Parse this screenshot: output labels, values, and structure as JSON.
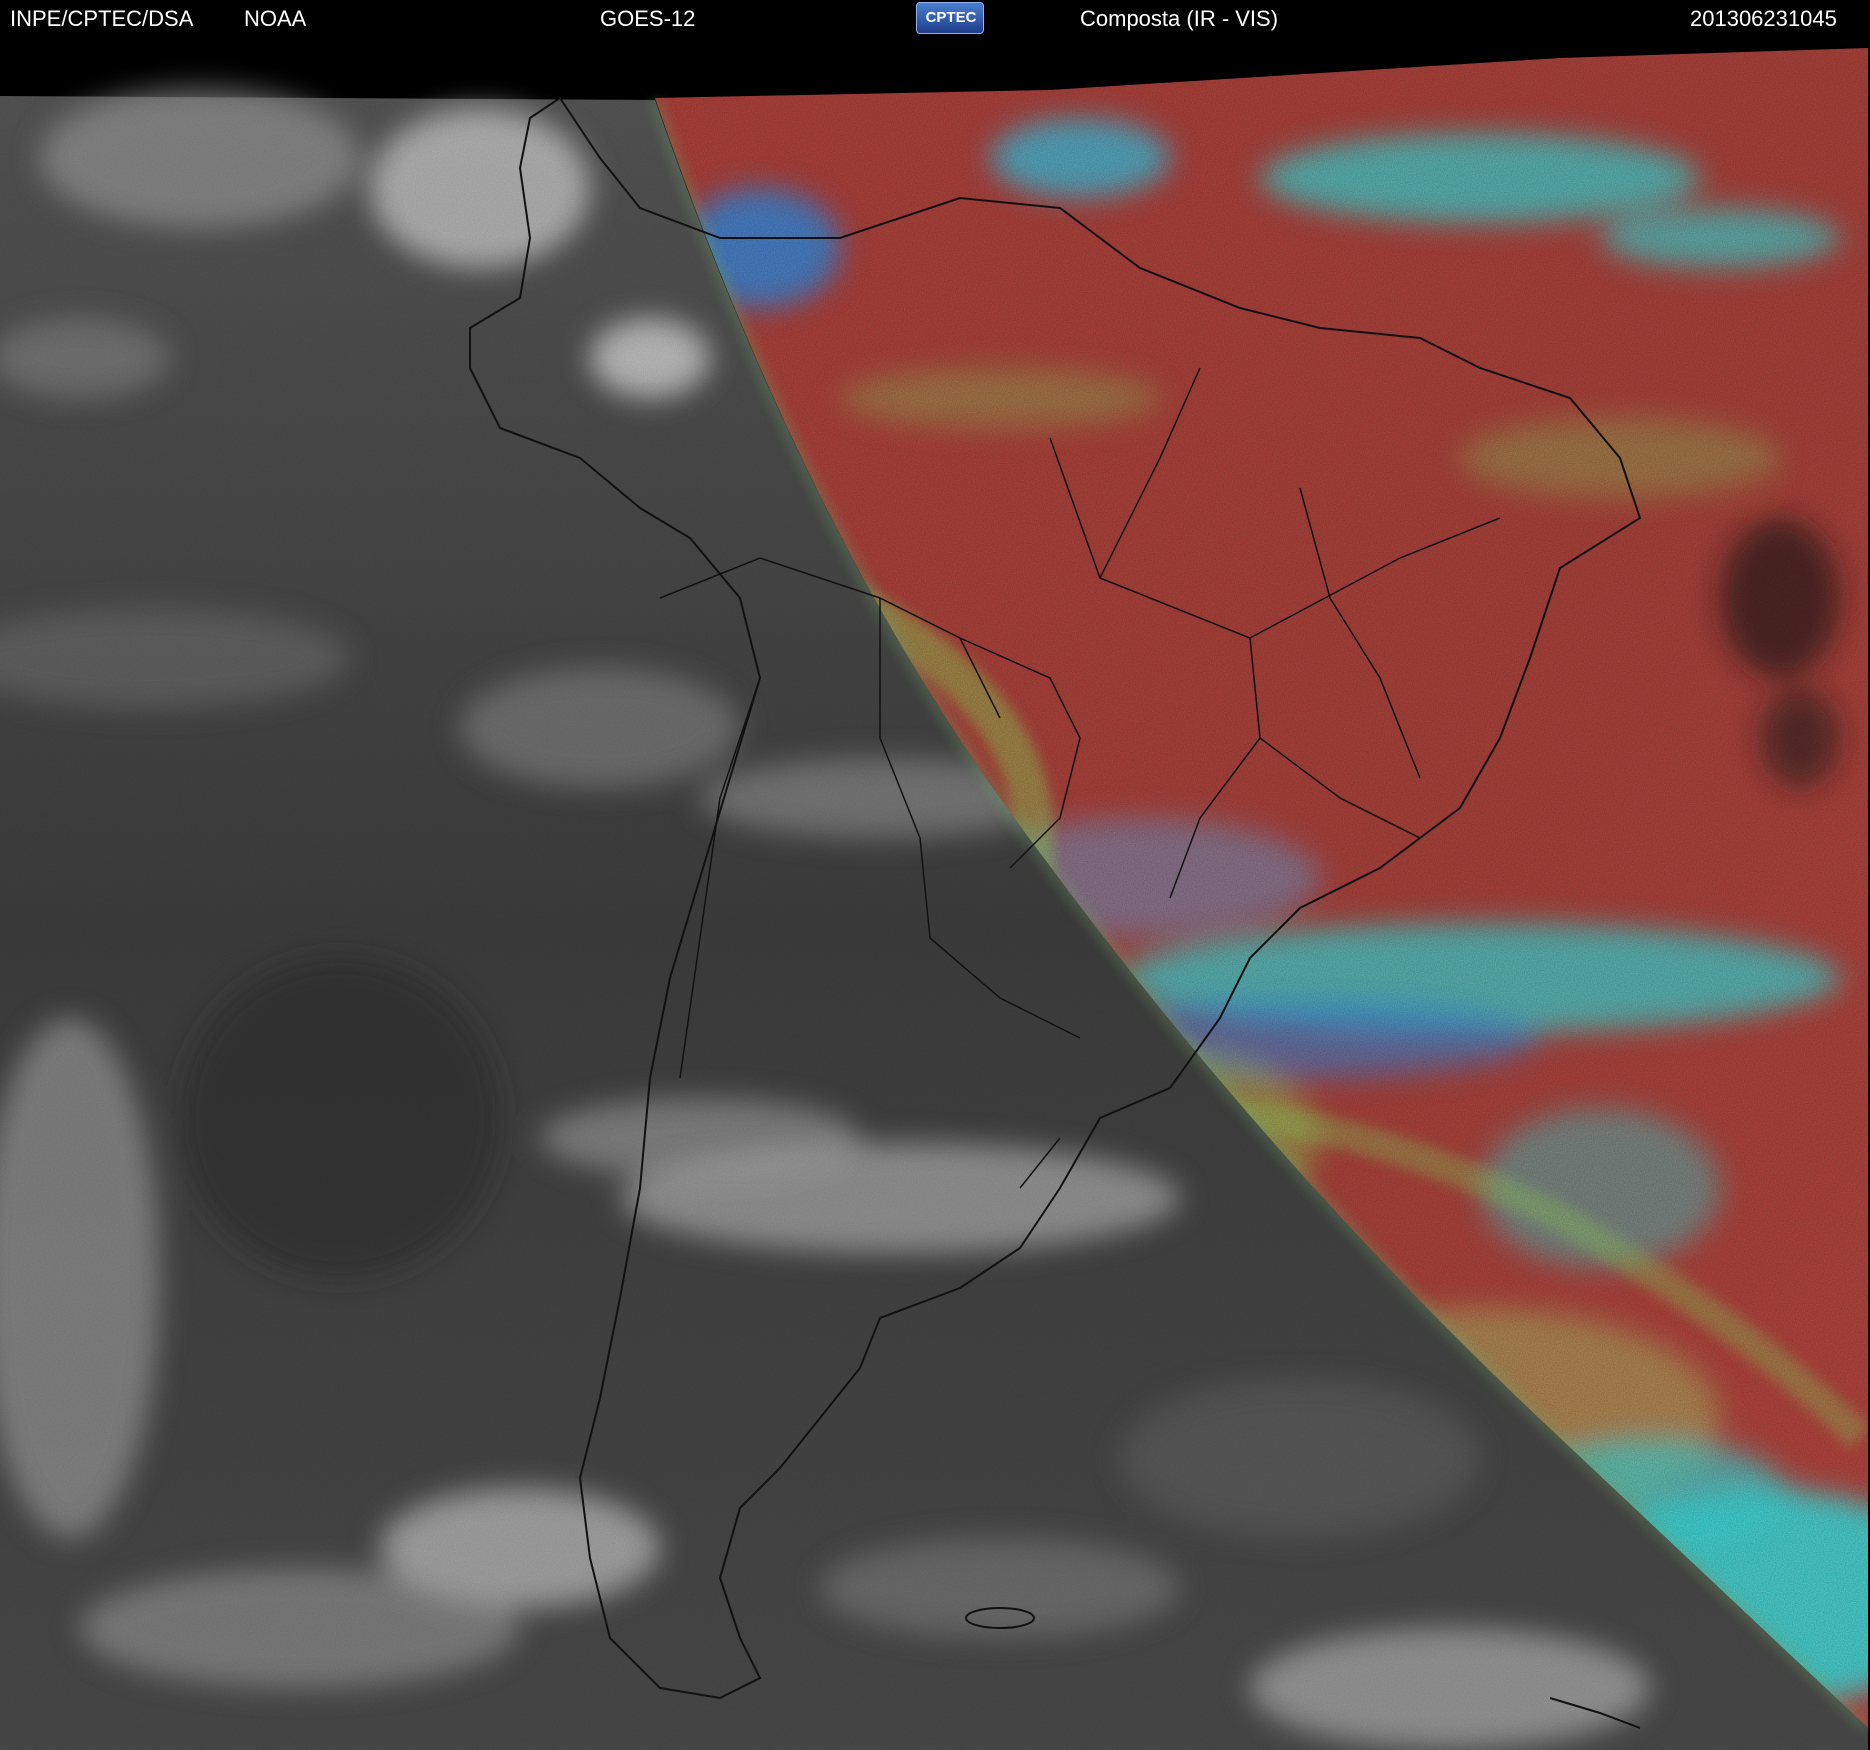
{
  "header": {
    "source": "INPE/CPTEC/DSA",
    "agency": "NOAA",
    "satellite": "GOES-12",
    "logo_text": "CPTEC",
    "product": "Composta (IR - VIS)",
    "timestamp": "201306231045"
  },
  "colors": {
    "background": "#000000",
    "ir_night_gray": "#4a4a4a",
    "vis_day_red": "#b54640",
    "cloud_cyan": "#41e0e0",
    "cloud_green": "#9be060",
    "cloud_blue": "#3a8fe8",
    "border_line": "#111111",
    "header_text": "#ffffff"
  },
  "icons": {
    "logo": "cptec-logo-icon"
  }
}
